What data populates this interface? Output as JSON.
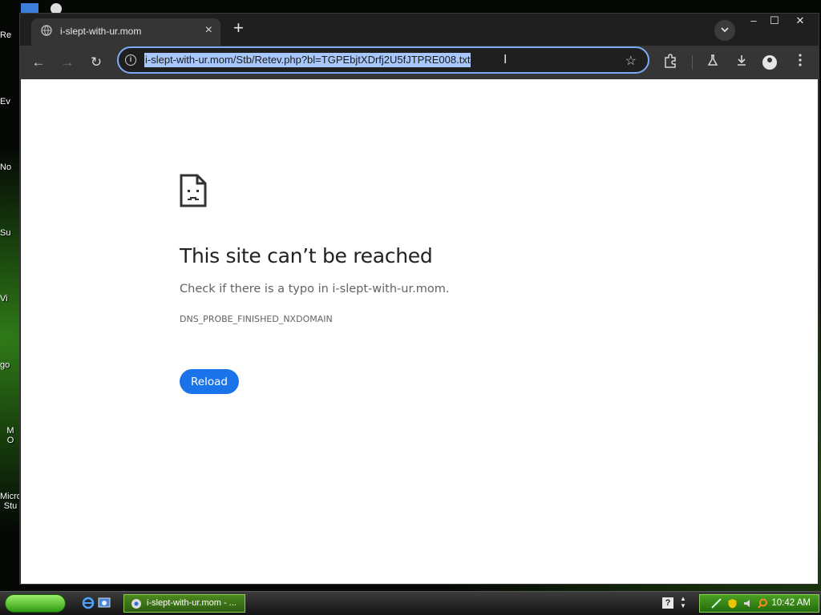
{
  "desktop": {
    "icons": [
      "Re",
      "Ev",
      "No",
      "Su",
      "Vi",
      "go",
      "M\nO",
      "Micro\nStu"
    ]
  },
  "browser": {
    "tab": {
      "title": "i-slept-with-ur.mom",
      "favicon": "globe-icon",
      "close": "×"
    },
    "new_tab": "+",
    "window_controls": {
      "minimize": "–",
      "maximize": "☐",
      "close": "✕"
    },
    "toolbar": {
      "back": "←",
      "forward": "→",
      "reload": "↻",
      "url": "i-slept-with-ur.mom/Stb/Retev.php?bl=TGPEbjtXDrfj2U5fJTPRE008.txt",
      "bookmark": "☆"
    },
    "icons": [
      "info-icon",
      "star-icon",
      "extensions-icon",
      "labs-flask-icon",
      "download-icon",
      "profile-icon",
      "menu-icon"
    ]
  },
  "error_page": {
    "title": "This site can’t be reached",
    "description": "Check if there is a typo in i-slept-with-ur.mom.",
    "error_code": "DNS_PROBE_FINISHED_NXDOMAIN",
    "reload_label": "Reload"
  },
  "taskbar": {
    "task_label": "i-slept-with-ur.mom - ...",
    "help": "?",
    "clock": "10:42 AM"
  },
  "colors": {
    "accent": "#1a73e8",
    "url_selection": "#a8c7fa",
    "omnibox_border": "#7cacf8",
    "taskbar_green": "#2e9b12"
  }
}
